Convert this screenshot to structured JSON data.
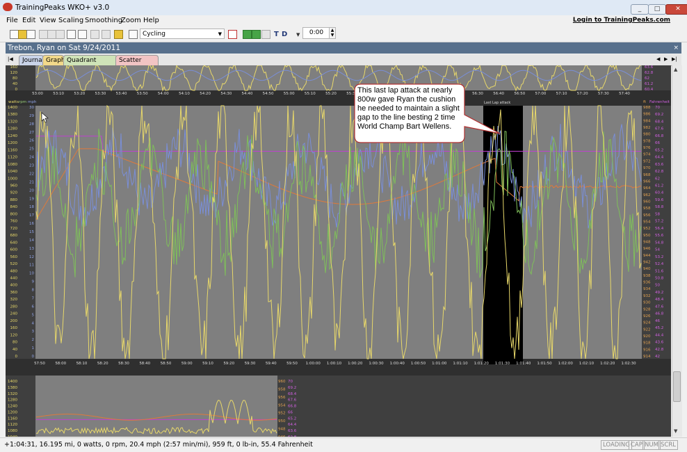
{
  "window": {
    "title": "TrainingPeaks WKO+ v3.0",
    "buttons": {
      "minimize": "_",
      "maximize": "□",
      "close": "✕"
    }
  },
  "menu": {
    "items": [
      "File",
      "Edit",
      "View",
      "Scaling",
      "Smoothing",
      "Zoom",
      "Help"
    ],
    "login": "Login to TrainingPeaks.com"
  },
  "toolbar": {
    "sport": "Cycling",
    "letters": [
      "T",
      "D"
    ],
    "time": "0:00"
  },
  "workout": {
    "header": "Trebon, Ryan on Sat 9/24/2011",
    "close": "×",
    "tabs": [
      "Journal",
      "Graph",
      "Quadrant Analysis",
      "Scatter Graph"
    ],
    "tab_colors": [
      "#c9d3e8",
      "#f2d98a",
      "#cfe3b8",
      "#f2c4c4"
    ],
    "active_tab": "Graph"
  },
  "graph": {
    "left_axis_units": [
      "watts",
      "rpm",
      "mph"
    ],
    "right_axis_units": [
      "ft",
      "Fahrenheit"
    ],
    "watts_ticks": [
      "1400",
      "1380",
      "1320",
      "1280",
      "1240",
      "1200",
      "1160",
      "1120",
      "1080",
      "1040",
      "1000",
      "960",
      "920",
      "880",
      "840",
      "800",
      "760",
      "720",
      "680",
      "640",
      "600",
      "560",
      "520",
      "480",
      "440",
      "400",
      "360",
      "320",
      "280",
      "240",
      "200",
      "160",
      "120",
      "80",
      "40",
      "0"
    ],
    "mph_ticks": [
      "30",
      "29",
      "28",
      "27",
      "26",
      "25",
      "24",
      "23",
      "22",
      "21",
      "20",
      "19",
      "18",
      "17",
      "16",
      "15",
      "14",
      "13",
      "12",
      "11",
      "10",
      "9",
      "8",
      "7",
      "6",
      "5",
      "4",
      "3",
      "2",
      "1",
      "0"
    ],
    "ft_ticks": [
      "988",
      "986",
      "984",
      "982",
      "980",
      "978",
      "976",
      "974",
      "972",
      "970",
      "968",
      "966",
      "964",
      "962",
      "960",
      "958",
      "956",
      "954",
      "952",
      "950",
      "948",
      "946",
      "944",
      "942",
      "940",
      "938",
      "936",
      "934",
      "932",
      "930",
      "928",
      "926",
      "924",
      "922",
      "920",
      "918",
      "916",
      "914"
    ],
    "temp_ticks": [
      "70",
      "69.2",
      "68.4",
      "67.6",
      "66.8",
      "66",
      "65.2",
      "64.4",
      "63.6",
      "62.8",
      "62",
      "61.2",
      "60.4",
      "59.6",
      "58.8",
      "58",
      "57.2",
      "56.4",
      "55.6",
      "54.8",
      "54",
      "53.2",
      "52.4",
      "51.6",
      "50.8",
      "50",
      "49.2",
      "48.4",
      "47.6",
      "46.8",
      "46",
      "45.2",
      "44.4",
      "43.6",
      "42.8",
      "42"
    ],
    "top_time_ticks": [
      "53:00",
      "53:10",
      "53:20",
      "53:30",
      "53:40",
      "53:50",
      "54:00",
      "54:10",
      "54:20",
      "54:30",
      "54:40",
      "54:50",
      "55:00",
      "55:10",
      "55:20",
      "55:30",
      "55:40",
      "55:50",
      "56:00",
      "56:10",
      "56:20",
      "56:30",
      "56:40",
      "56:50",
      "57:00",
      "57:10",
      "57:20",
      "57:30",
      "57:40"
    ],
    "main_time_ticks": [
      "57:50",
      "58:00",
      "58:10",
      "58:20",
      "58:30",
      "58:40",
      "58:50",
      "59:00",
      "59:10",
      "59:20",
      "59:30",
      "59:40",
      "59:50",
      "1:00:00",
      "1:00:10",
      "1:00:20",
      "1:00:30",
      "1:00:40",
      "1:00:50",
      "1:01:00",
      "1:01:10",
      "1:01:20",
      "1:01:30",
      "1:01:40",
      "1:01:50",
      "1:02:00",
      "1:02:10",
      "1:02:20",
      "1:02:30"
    ],
    "lap_label": "Last Lap attack",
    "series_colors": {
      "power": "#e8d86a",
      "speed": "#7a8fd8",
      "cadence": "#7fbf5a",
      "elevation": "#e07a3a",
      "temperature": "#c040d0"
    }
  },
  "callout": {
    "text": "This last lap attack at nearly 800w gave Ryan the cushion he needed to maintain a slight gap to the line besting 2 time World Champ Bart Wellens."
  },
  "status": {
    "text": "+1:04:31, 16.195 mi, 0 watts, 0 rpm, 20.4 mph (2:57 min/mi), 959 ft, 0 lb-in, 55.4 Fahrenheit",
    "indicators": [
      "LOADING",
      "CAP",
      "NUM",
      "SCRL"
    ]
  }
}
